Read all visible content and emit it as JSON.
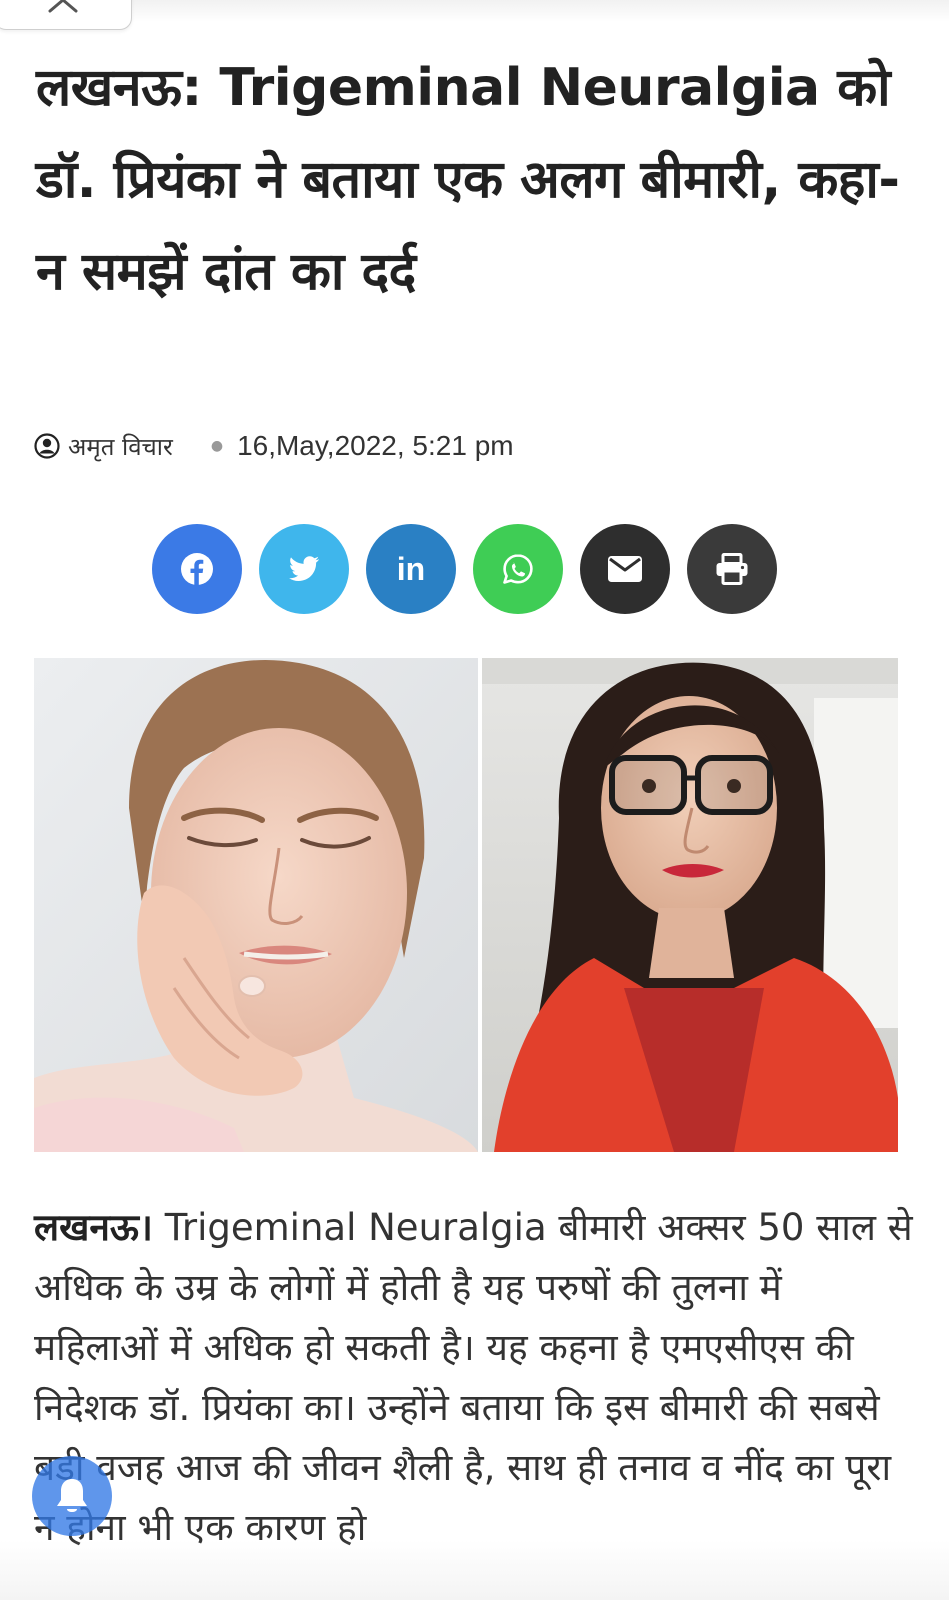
{
  "article": {
    "title": "लखनऊ: Trigeminal Neuralgia को डॉ. प्रियंका ने बताया एक अलग बीमारी, कहा- न समझें दांत का दर्द",
    "author": "अमृत विचार",
    "date": "16,May,2022, 5:21 pm",
    "body_lead": "लखनऊ।",
    "body": " Trigeminal Neuralgia बीमारी अक्सर 50 साल से अधिक के उम्र के लोगों में होती है यह परुषों की तुलना में महिलाओं में अधिक हो सकती है। यह कहना है एमएसीएस की निदेशक डॉ. प्रियंका का। उन्होंने बताया कि इस बीमारी की सबसे बड़ी वजह आज की जीवन शैली है, साथ ही तनाव व नींद का पूरा न होना भी एक कारण हो"
  },
  "share": {
    "buttons": [
      {
        "name": "facebook",
        "icon": "facebook-icon",
        "color": "#3b7ae6"
      },
      {
        "name": "twitter",
        "icon": "twitter-icon",
        "color": "#3fb6ec"
      },
      {
        "name": "linkedin",
        "icon": "linkedin-icon",
        "label": "in",
        "color": "#2a80c4"
      },
      {
        "name": "whatsapp",
        "icon": "whatsapp-icon",
        "color": "#3fcd55"
      },
      {
        "name": "email",
        "icon": "envelope-icon",
        "color": "#2e2e2e"
      },
      {
        "name": "print",
        "icon": "printer-icon",
        "color": "#3a3a3a"
      }
    ]
  },
  "icons": {
    "top_tab": "chevron-up-icon",
    "author": "user-circle-icon",
    "notification": "bell-icon"
  }
}
